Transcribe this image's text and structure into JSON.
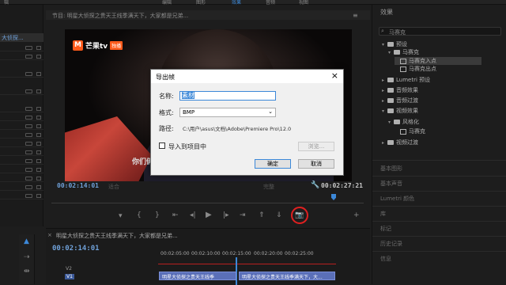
{
  "menu": {
    "items": [
      "辑",
      "编辑",
      "图形",
      "效果",
      "音频",
      "视图"
    ]
  },
  "program_monitor": {
    "title": "节目: 明星大侦探之贵天王线季满天下，大家都是兄弟...",
    "logo_brand": "芒果tv",
    "logo_badge": "独播",
    "subtitle_text": "你们俩",
    "timecode_current": "00:02:14:01",
    "timecode_total": "00:02:27:21",
    "fit_select": "适合",
    "quality_select": "完整"
  },
  "project_panel": {
    "name": "大侦探..."
  },
  "timeline": {
    "title": "明星大侦探之贵天王线季满天下，大家都是兄弟...",
    "timecode": "00:02:14:01",
    "ruler_labels": [
      "00:02:05:00",
      "00:02:10:00",
      "00:02:15:00",
      "00:02:20:00",
      "00:02:25:00"
    ],
    "tracks": [
      "V2",
      "V1"
    ],
    "clip_a": "明星大侦探之贵天王线季",
    "clip_b": "明星大侦探之贵天王线季满天下，大..."
  },
  "effects_panel": {
    "title": "效果",
    "search_value": "马赛克",
    "tree": [
      {
        "label": "预设",
        "kind": "folder",
        "level": 0,
        "open": true
      },
      {
        "label": "马赛克",
        "kind": "folder",
        "level": 1,
        "open": true
      },
      {
        "label": "马赛克入点",
        "kind": "fx",
        "level": 2,
        "selected": true
      },
      {
        "label": "马赛克出点",
        "kind": "fx",
        "level": 2
      },
      {
        "label": "Lumetri 预设",
        "kind": "folder",
        "level": 0
      },
      {
        "label": "音频效果",
        "kind": "folder",
        "level": 0
      },
      {
        "label": "音频过渡",
        "kind": "folder",
        "level": 0
      },
      {
        "label": "视频效果",
        "kind": "folder",
        "level": 0,
        "open": true
      },
      {
        "label": "风格化",
        "kind": "folder",
        "level": 1,
        "open": true
      },
      {
        "label": "马赛克",
        "kind": "fx",
        "level": 2
      },
      {
        "label": "视频过渡",
        "kind": "folder",
        "level": 0
      }
    ],
    "sections": [
      "基本图形",
      "基本声音",
      "Lumetri 颜色",
      "库",
      "标记",
      "历史记录",
      "信息"
    ]
  },
  "export_frame_dialog": {
    "title": "导出帧",
    "name_label": "名称:",
    "name_value": "素材",
    "format_label": "格式:",
    "format_value": "BMP",
    "path_label": "路径:",
    "path_value": "C:\\用户\\asus\\文档\\Adobe\\Premiere Pro\\12.0",
    "import_label": "导入到项目中",
    "browse_label": "浏览...",
    "ok_label": "确定",
    "cancel_label": "取消"
  },
  "colors": {
    "timecode": "#6fa0d8",
    "accent": "#3c88d8",
    "highlight_circle": "#e02020",
    "clip": "#5a6fb8"
  }
}
